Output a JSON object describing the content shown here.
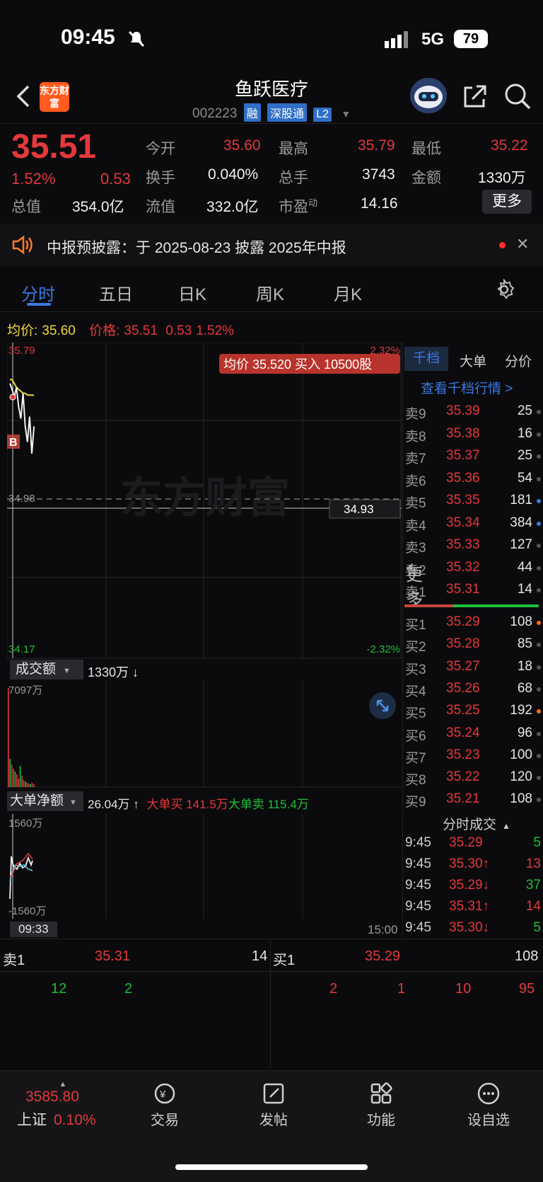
{
  "status": {
    "time": "09:45",
    "network": "5G",
    "battery": "79"
  },
  "header": {
    "logo_text": "东方财富",
    "title": "鱼跃医疗",
    "code": "002223",
    "tags": [
      "融",
      "深股通",
      "L2"
    ]
  },
  "quote": {
    "price": "35.51",
    "pct": "1.52%",
    "change": "0.53",
    "open_label": "今开",
    "open": "35.60",
    "high_label": "最高",
    "high": "35.79",
    "low_label": "最低",
    "low": "35.22",
    "turnover_label": "换手",
    "turnover": "0.040%",
    "volume_label": "总手",
    "volume": "3743",
    "amount_label": "金额",
    "amount": "1330万",
    "mktcap_label": "总值",
    "mktcap": "354.0亿",
    "float_label": "流值",
    "float": "332.0亿",
    "pe_label": "市盈",
    "pe_sup": "动",
    "pe": "14.16",
    "more": "更多"
  },
  "notice": {
    "text": "中报预披露：于 2025-08-23 披露 2025年中报"
  },
  "tabs": [
    "分时",
    "五日",
    "日K",
    "周K",
    "月K",
    "更多"
  ],
  "legend": {
    "avg_label": "均价:",
    "avg": "35.60",
    "price_label": "价格:",
    "price": "35.51",
    "change": "0.53",
    "pct": "1.52%"
  },
  "chart_data": {
    "type": "line",
    "y_top": "35.79",
    "y_mid": "34.98",
    "y_bottom": "34.17",
    "pct_top": "2.32%",
    "pct_bottom": "-2.32%",
    "cursor_price": "34.93",
    "tooltip": "均价 35.520 买入 10500股",
    "marker": "B",
    "ylim": [
      34.17,
      35.79
    ],
    "price_series": [
      35.58,
      35.55,
      35.51,
      35.56,
      35.46,
      35.4,
      35.53,
      35.36,
      35.28,
      35.41,
      35.22,
      35.36
    ],
    "avg_series": [
      35.6,
      35.6,
      35.58,
      35.56,
      35.55,
      35.54,
      35.53,
      35.53,
      35.52,
      35.52,
      35.52,
      35.52
    ],
    "watermark": "东方财富"
  },
  "volume": {
    "selector": "成交额",
    "value": "1330万 ↓",
    "max_label": "7097万"
  },
  "bigorder": {
    "selector": "大单净额",
    "value": "26.04万 ↑",
    "buy": "大单买 141.5万",
    "sell": "大单卖 115.4万",
    "max_label": "1560万",
    "min_label": "-1560万"
  },
  "time_axis": {
    "start": "09:33",
    "end": "15:00"
  },
  "orderbook": {
    "tabs": [
      "千档",
      "大单",
      "分价"
    ],
    "link": "查看千档行情 >",
    "asks": [
      {
        "k": "卖9",
        "p": "35.39",
        "v": "25",
        "dot": "#555"
      },
      {
        "k": "卖8",
        "p": "35.38",
        "v": "16",
        "dot": "#555"
      },
      {
        "k": "卖7",
        "p": "35.37",
        "v": "25",
        "dot": "#555"
      },
      {
        "k": "卖6",
        "p": "35.36",
        "v": "54",
        "dot": "#555"
      },
      {
        "k": "卖5",
        "p": "35.35",
        "v": "181",
        "dot": "#3a7be0"
      },
      {
        "k": "卖4",
        "p": "35.34",
        "v": "384",
        "dot": "#3a7be0"
      },
      {
        "k": "卖3",
        "p": "35.33",
        "v": "127",
        "dot": "#555"
      },
      {
        "k": "卖2",
        "p": "35.32",
        "v": "44",
        "dot": "#555"
      },
      {
        "k": "卖1",
        "p": "35.31",
        "v": "14",
        "dot": "#555"
      }
    ],
    "bids": [
      {
        "k": "买1",
        "p": "35.29",
        "v": "108",
        "dot": "#ff6a1a"
      },
      {
        "k": "买2",
        "p": "35.28",
        "v": "85",
        "dot": "#555"
      },
      {
        "k": "买3",
        "p": "35.27",
        "v": "18",
        "dot": "#555"
      },
      {
        "k": "买4",
        "p": "35.26",
        "v": "68",
        "dot": "#555"
      },
      {
        "k": "买5",
        "p": "35.25",
        "v": "192",
        "dot": "#ff6a1a"
      },
      {
        "k": "买6",
        "p": "35.24",
        "v": "96",
        "dot": "#555"
      },
      {
        "k": "买7",
        "p": "35.23",
        "v": "100",
        "dot": "#555"
      },
      {
        "k": "买8",
        "p": "35.22",
        "v": "120",
        "dot": "#555"
      },
      {
        "k": "买9",
        "p": "35.21",
        "v": "108",
        "dot": "#555"
      }
    ],
    "ticks_title": "分时成交",
    "ticks": [
      {
        "t": "9:45",
        "p": "35.29",
        "v": "5",
        "vc": "green"
      },
      {
        "t": "9:45",
        "p": "35.30↑",
        "v": "13",
        "vc": "red"
      },
      {
        "t": "9:45",
        "p": "35.29↓",
        "v": "37",
        "vc": "green"
      },
      {
        "t": "9:45",
        "p": "35.31↑",
        "v": "14",
        "vc": "red"
      },
      {
        "t": "9:45",
        "p": "35.30↓",
        "v": "5",
        "vc": "green"
      }
    ]
  },
  "bottom_quote": {
    "ask_label": "卖1",
    "ask_price": "35.31",
    "ask_vol": "14",
    "bid_label": "买1",
    "bid_price": "35.29",
    "bid_vol": "108",
    "ask_queue": [
      "12",
      "2"
    ],
    "bid_queue": [
      "2",
      "1",
      "10",
      "95"
    ]
  },
  "index": {
    "value": "3585.80",
    "name": "上证",
    "pct": "0.10%"
  },
  "nav": [
    "交易",
    "发帖",
    "功能",
    "设自选"
  ]
}
